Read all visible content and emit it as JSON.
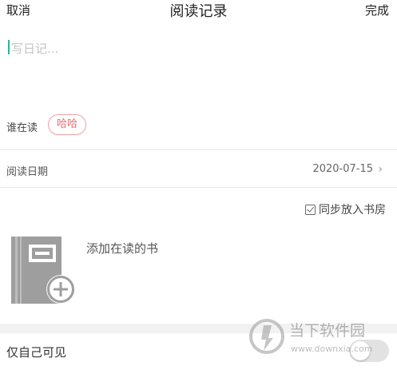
{
  "header": {
    "cancel_label": "取消",
    "title": "阅读记录",
    "done_label": "完成"
  },
  "editor": {
    "placeholder": "写日记..."
  },
  "who_reading": {
    "label": "谁在读",
    "chip": "哈哈"
  },
  "reading_date": {
    "label": "阅读日期",
    "value": "2020-07-15"
  },
  "sync": {
    "label": "同步放入书房",
    "checked": true
  },
  "book": {
    "add_label": "添加在读的书"
  },
  "privacy": {
    "label": "仅自己可见",
    "enabled": false
  },
  "watermark": {
    "name": "当下软件园",
    "url": "www.downxia.com"
  },
  "colors": {
    "accent_caret": "#2bb39b",
    "chip_border": "#f0a0a0",
    "chip_text": "#e26a6a"
  }
}
